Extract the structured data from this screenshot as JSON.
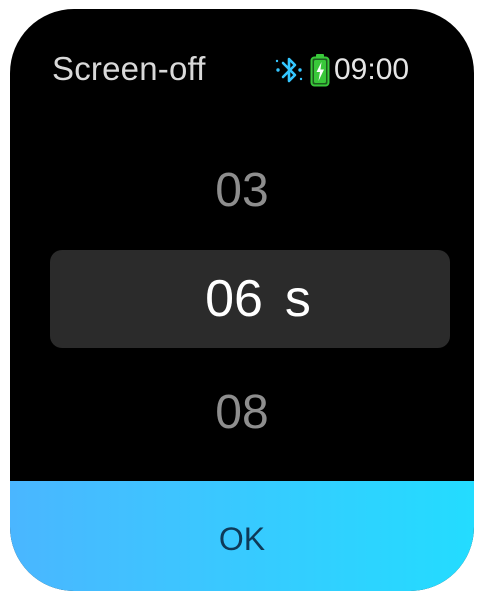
{
  "header": {
    "title": "Screen-off",
    "time": "09:00"
  },
  "status_icons": {
    "bluetooth": "bluetooth-icon",
    "battery": "battery-charging-icon"
  },
  "picker": {
    "previous_value": "03",
    "selected_value": "06",
    "unit": "s",
    "next_value": "08"
  },
  "actions": {
    "ok_label": "OK"
  },
  "colors": {
    "background": "#000000",
    "selection_band": "#2b2b2b",
    "ok_gradient_start": "#4ab6ff",
    "ok_gradient_end": "#23dcff",
    "bluetooth": "#34c6ff",
    "battery": "#39c83a"
  }
}
